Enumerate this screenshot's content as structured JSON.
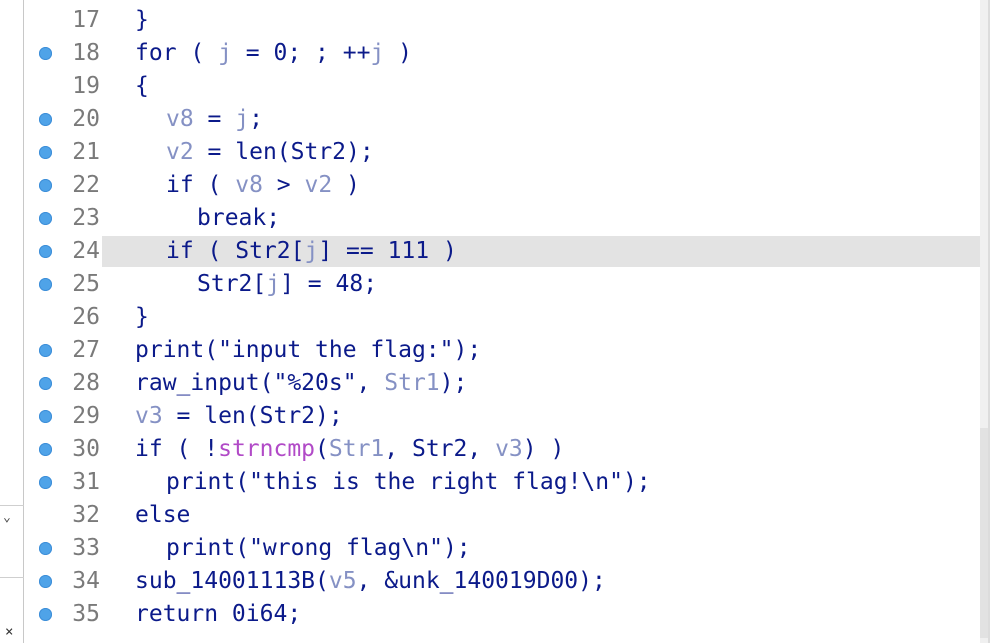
{
  "colors": {
    "code_text": "#0b1a8a",
    "variable": "#8591c4",
    "import_func": "#b14ac7",
    "line_number": "#7a7a7a",
    "breakpoint_dot": "#4fa3e8",
    "current_line_highlight": "#e3e3e3"
  },
  "sidebar": {
    "chevron_icon": "chevron-down-icon",
    "close_icon": "close-icon"
  },
  "lines": [
    {
      "n": "17",
      "bp": false,
      "hl": false,
      "indent": 0,
      "t": [
        [
          "}",
          ""
        ]
      ]
    },
    {
      "n": "18",
      "bp": true,
      "hl": false,
      "indent": 0,
      "t": [
        [
          "for ( ",
          ""
        ],
        [
          "j",
          "v"
        ],
        [
          " = 0; ; ++",
          ""
        ],
        [
          "j",
          "v"
        ],
        [
          " )",
          ""
        ]
      ]
    },
    {
      "n": "19",
      "bp": false,
      "hl": false,
      "indent": 0,
      "t": [
        [
          "{",
          ""
        ]
      ]
    },
    {
      "n": "20",
      "bp": true,
      "hl": false,
      "indent": 1,
      "t": [
        [
          "v8",
          "v"
        ],
        [
          " = ",
          ""
        ],
        [
          "j",
          "v"
        ],
        [
          ";",
          ""
        ]
      ]
    },
    {
      "n": "21",
      "bp": true,
      "hl": false,
      "indent": 1,
      "t": [
        [
          "v2",
          "v"
        ],
        [
          " = len(Str2);",
          ""
        ]
      ]
    },
    {
      "n": "22",
      "bp": true,
      "hl": false,
      "indent": 1,
      "t": [
        [
          "if ( ",
          ""
        ],
        [
          "v8",
          "v"
        ],
        [
          " > ",
          ""
        ],
        [
          "v2",
          "v"
        ],
        [
          " )",
          ""
        ]
      ]
    },
    {
      "n": "23",
      "bp": true,
      "hl": false,
      "indent": 2,
      "t": [
        [
          "break;",
          ""
        ]
      ]
    },
    {
      "n": "24",
      "bp": true,
      "hl": true,
      "indent": 1,
      "t": [
        [
          "if ( Str2[",
          ""
        ],
        [
          "j",
          "v"
        ],
        [
          "] == 111 )",
          ""
        ]
      ]
    },
    {
      "n": "25",
      "bp": true,
      "hl": false,
      "indent": 2,
      "t": [
        [
          "Str2[",
          ""
        ],
        [
          "j",
          "v"
        ],
        [
          "] = 48;",
          ""
        ]
      ]
    },
    {
      "n": "26",
      "bp": false,
      "hl": false,
      "indent": 0,
      "t": [
        [
          "}",
          ""
        ]
      ]
    },
    {
      "n": "27",
      "bp": true,
      "hl": false,
      "indent": 0,
      "t": [
        [
          "print(\"input the flag:\");",
          ""
        ]
      ]
    },
    {
      "n": "28",
      "bp": true,
      "hl": false,
      "indent": 0,
      "t": [
        [
          "raw_input(\"%20s\", ",
          ""
        ],
        [
          "Str1",
          "v"
        ],
        [
          ");",
          ""
        ]
      ]
    },
    {
      "n": "29",
      "bp": true,
      "hl": false,
      "indent": 0,
      "t": [
        [
          "v3",
          "v"
        ],
        [
          " = len(Str2);",
          ""
        ]
      ]
    },
    {
      "n": "30",
      "bp": true,
      "hl": false,
      "indent": 0,
      "t": [
        [
          "if ( !",
          ""
        ],
        [
          "strncmp",
          "f"
        ],
        [
          "(",
          ""
        ],
        [
          "Str1",
          "v"
        ],
        [
          ", Str2, ",
          ""
        ],
        [
          "v3",
          "v"
        ],
        [
          ") )",
          ""
        ]
      ]
    },
    {
      "n": "31",
      "bp": true,
      "hl": false,
      "indent": 1,
      "t": [
        [
          "print(\"this is the right flag!\\n\");",
          ""
        ]
      ]
    },
    {
      "n": "32",
      "bp": false,
      "hl": false,
      "indent": 0,
      "t": [
        [
          "else",
          ""
        ]
      ]
    },
    {
      "n": "33",
      "bp": true,
      "hl": false,
      "indent": 1,
      "t": [
        [
          "print(\"wrong flag\\n\");",
          ""
        ]
      ]
    },
    {
      "n": "34",
      "bp": true,
      "hl": false,
      "indent": 0,
      "t": [
        [
          "sub_14001113B(",
          ""
        ],
        [
          "v5",
          "v"
        ],
        [
          ", &unk_140019D00);",
          ""
        ]
      ]
    },
    {
      "n": "35",
      "bp": true,
      "hl": false,
      "indent": 0,
      "t": [
        [
          "return 0i64;",
          ""
        ]
      ]
    }
  ]
}
